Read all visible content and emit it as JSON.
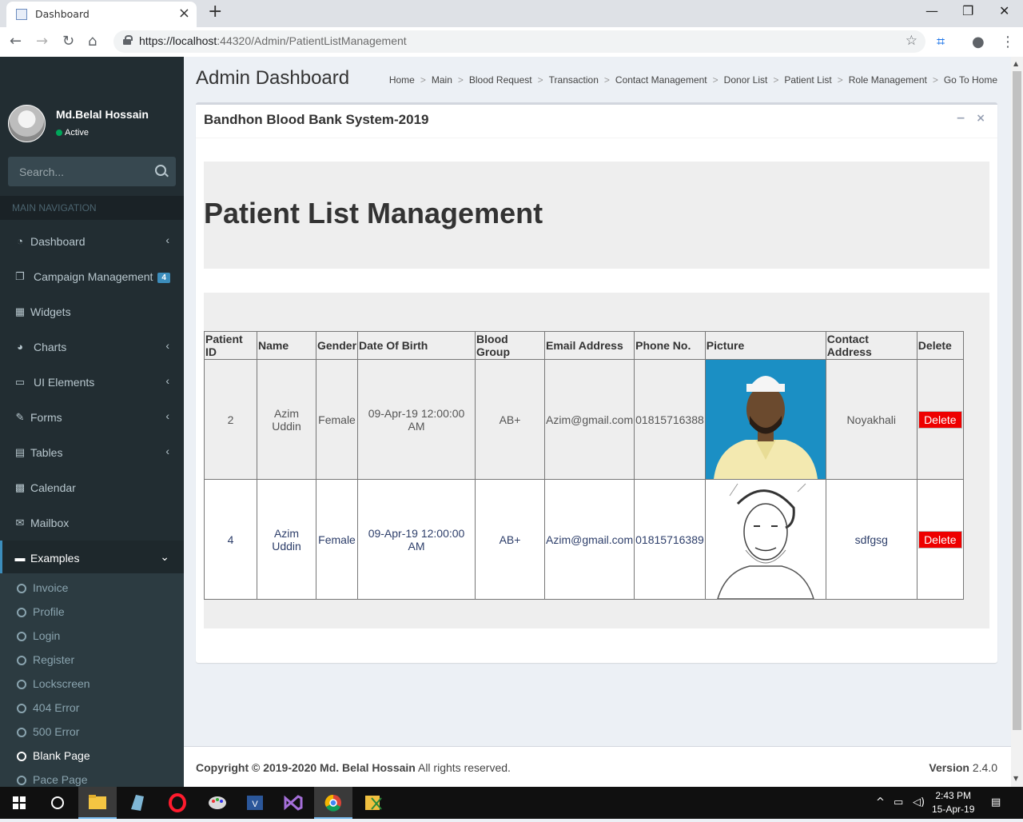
{
  "browser": {
    "tab_title": "Dashboard",
    "url_host": "https://localhost",
    "url_rest": ":44320/Admin/PatientListManagement"
  },
  "user": {
    "name": "Md.Belal Hossain",
    "status": "Active"
  },
  "sidebar": {
    "search_placeholder": "Search...",
    "header": "MAIN NAVIGATION",
    "items": [
      {
        "label": "Dashboard",
        "icon": "dashboard-icon"
      },
      {
        "label": "Campaign Management",
        "icon": "files-icon",
        "badge": "4"
      },
      {
        "label": "Widgets",
        "icon": "th-icon"
      },
      {
        "label": "Charts",
        "icon": "pie-chart-icon"
      },
      {
        "label": "UI Elements",
        "icon": "laptop-icon"
      },
      {
        "label": "Forms",
        "icon": "edit-icon"
      },
      {
        "label": "Tables",
        "icon": "table-icon"
      },
      {
        "label": "Calendar",
        "icon": "calendar-icon"
      },
      {
        "label": "Mailbox",
        "icon": "envelope-icon"
      },
      {
        "label": "Examples",
        "icon": "folder-icon"
      }
    ],
    "sub_items": [
      "Invoice",
      "Profile",
      "Login",
      "Register",
      "Lockscreen",
      "404 Error",
      "500 Error",
      "Blank Page",
      "Pace Page"
    ]
  },
  "header": {
    "title": "Admin Dashboard",
    "breadcrumb": [
      "Home",
      "Main",
      "Blood Request",
      "Transaction",
      "Contact Management",
      "Donor List",
      "Patient List",
      "Role Management",
      "Go To Home"
    ],
    "separator": ">"
  },
  "box": {
    "title": "Bandhon Blood Bank System-2019",
    "heading": "Patient List Management"
  },
  "table": {
    "columns": [
      "Patient ID",
      "Name",
      "Gender",
      "Date Of Birth",
      "Blood Group",
      "Email Address",
      "Phone No.",
      "Picture",
      "Contact Address",
      "Delete"
    ],
    "rows": [
      {
        "id": "2",
        "name": "Azim Uddin",
        "gender": "Female",
        "dob": "09-Apr-19 12:00:00 AM",
        "blood": "AB+",
        "email": "Azim@gmail.com",
        "phone": "01815716388",
        "address": "Noyakhali",
        "delete": "Delete"
      },
      {
        "id": "4",
        "name": "Azim Uddin",
        "gender": "Female",
        "dob": "09-Apr-19 12:00:00 AM",
        "blood": "AB+",
        "email": "Azim@gmail.com",
        "phone": "01815716389",
        "address": "sdfgsg",
        "delete": "Delete"
      }
    ]
  },
  "footer": {
    "copyright": "Copyright © 2019-2020 Md. Belal Hossain",
    "rights": " All rights reserved.",
    "version_label": "Version",
    "version": " 2.4.0"
  },
  "taskbar": {
    "time": "2:43 PM",
    "date": "15-Apr-19"
  },
  "colors": {
    "sidebar": "#222d32",
    "accent": "#3c8dbc",
    "delete": "#ee0000",
    "active_dot": "#00a65a"
  }
}
